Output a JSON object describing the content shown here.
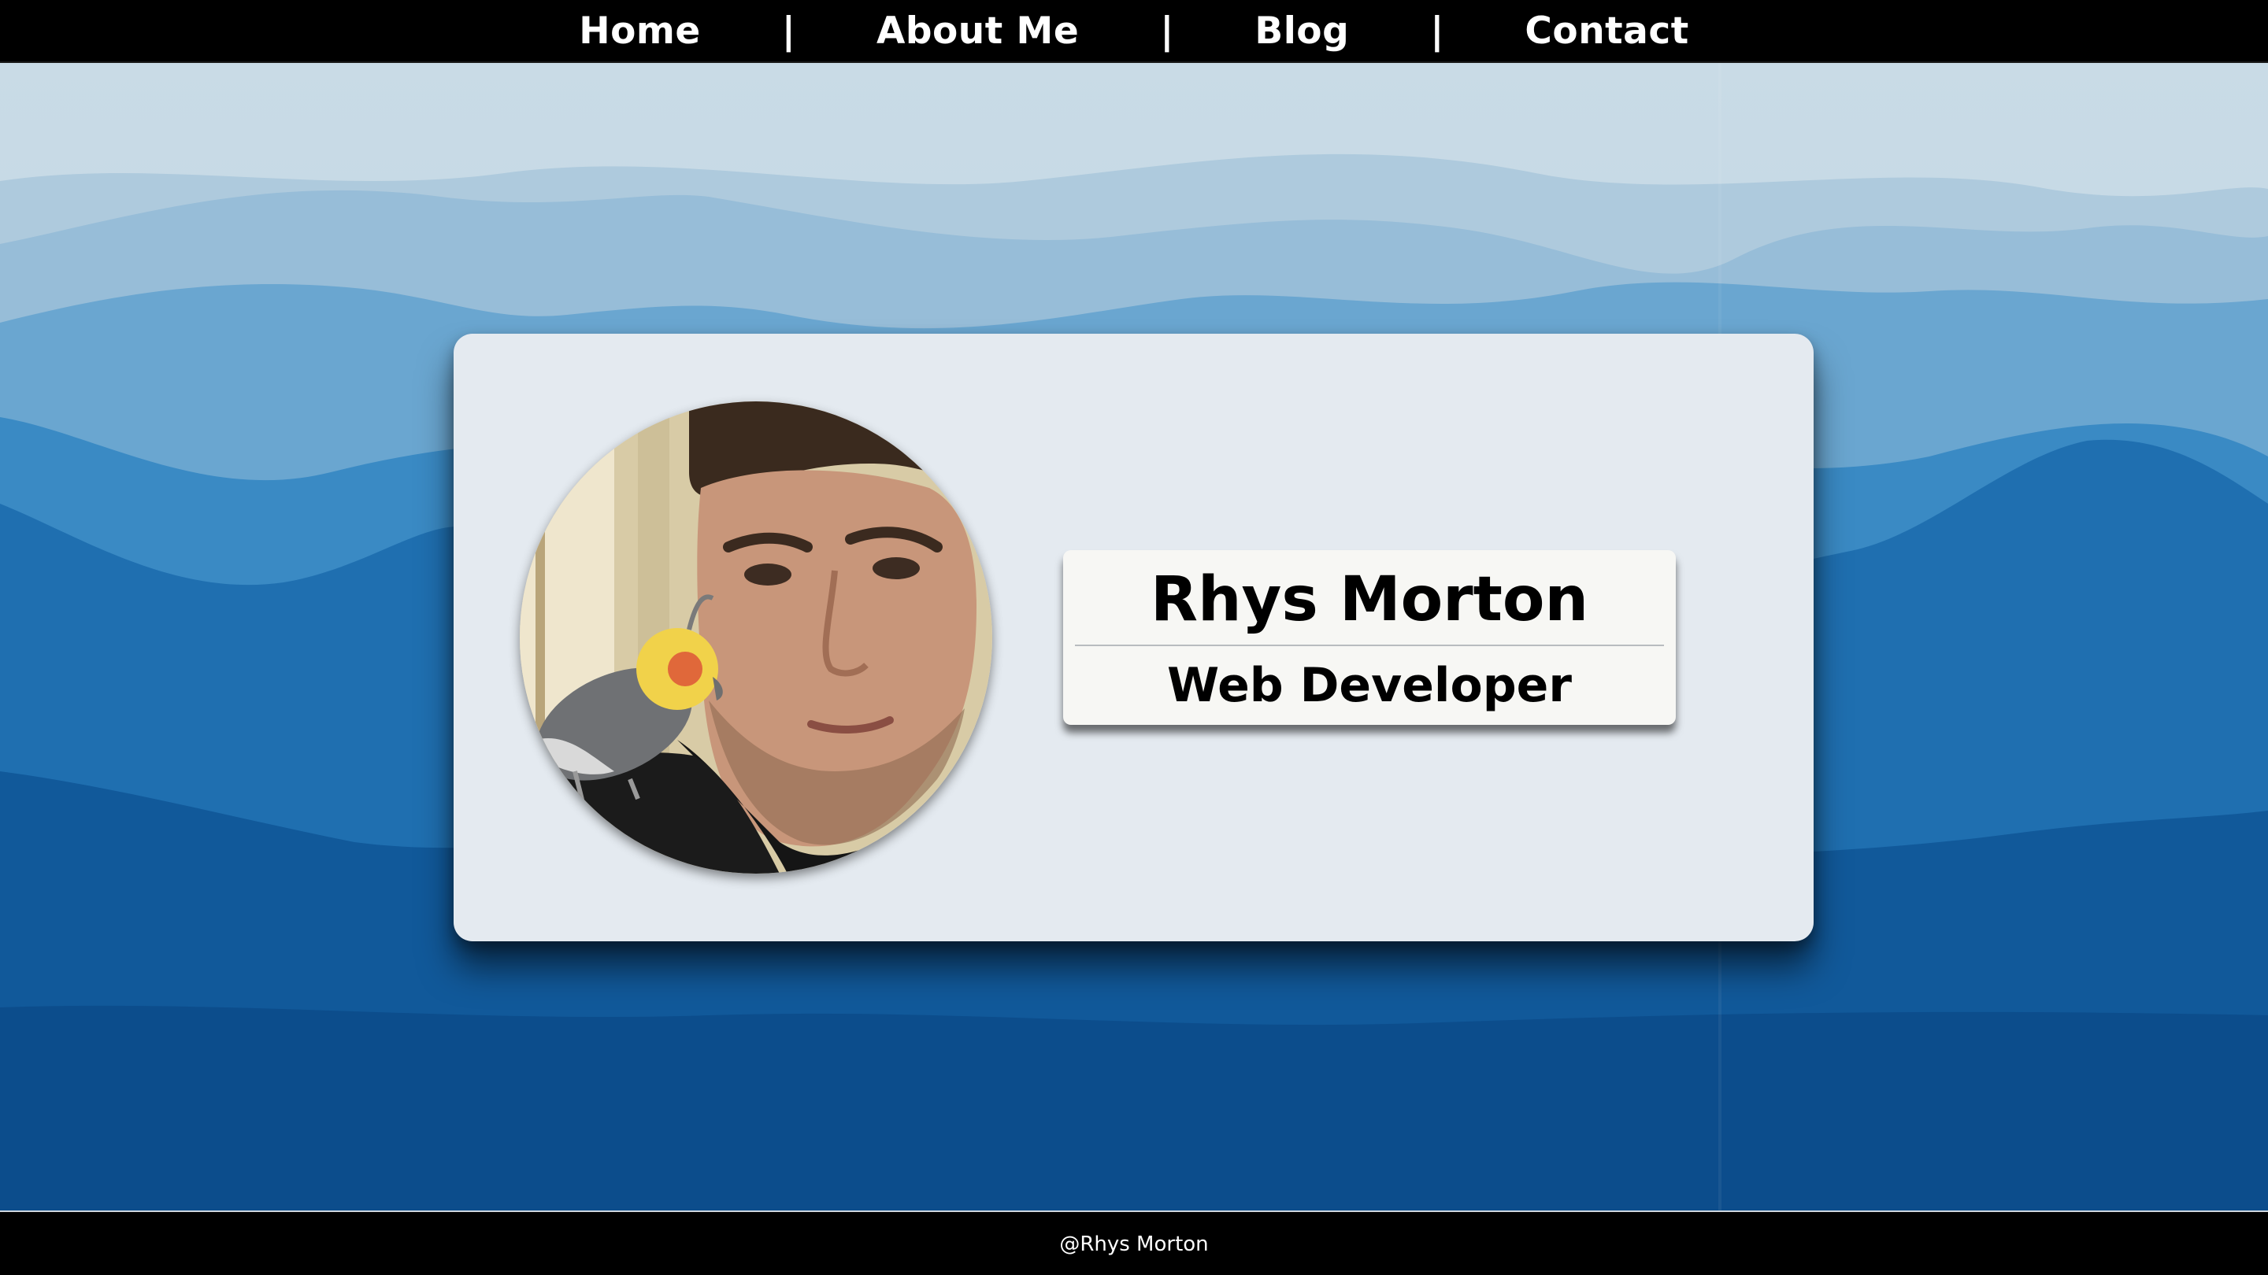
{
  "nav": {
    "items": [
      {
        "label": "Home"
      },
      {
        "label": "About Me"
      },
      {
        "label": "Blog"
      },
      {
        "label": "Contact"
      }
    ],
    "separator": "|"
  },
  "profile": {
    "name": "Rhys Morton",
    "title": "Web Developer",
    "photo_description": "profile-photo"
  },
  "footer": {
    "text": "@Rhys Morton"
  },
  "colors": {
    "nav_bg": "#000000",
    "card_bg": "#e4eaf0",
    "plate_bg": "#f7f7f4",
    "sky_top": "#c6d9e6",
    "mountains_deep": "#0d5495"
  }
}
